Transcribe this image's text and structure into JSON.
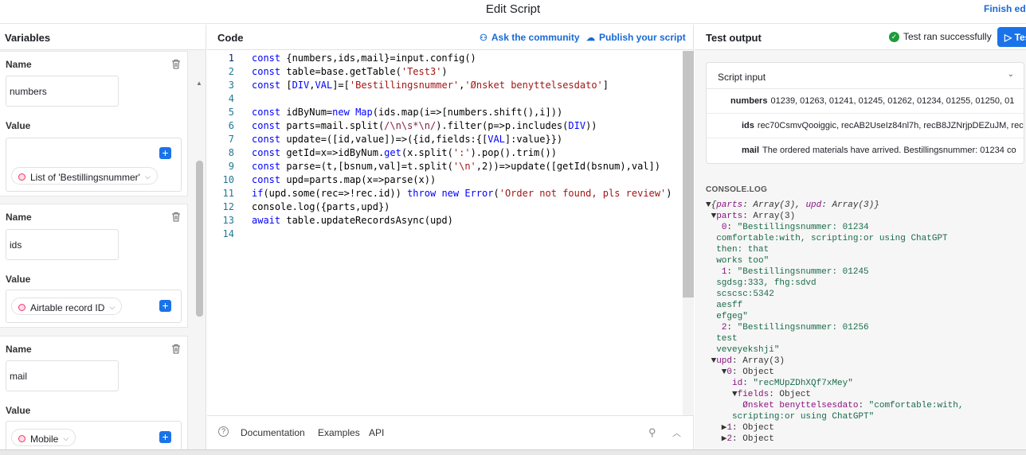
{
  "header": {
    "title": "Edit Script",
    "finish_label": "Finish editing"
  },
  "variables": {
    "title": "Variables",
    "name_label": "Name",
    "value_label": "Value",
    "items": [
      {
        "name": "numbers",
        "value_label": "List of 'Bestillingsnummer'"
      },
      {
        "name": "ids",
        "value_label": "Airtable record ID"
      },
      {
        "name": "mail",
        "value_label": "Mobile"
      }
    ]
  },
  "code": {
    "title": "Code",
    "ask_community": "Ask the community",
    "publish": "Publish your script",
    "line_numbers": [
      "1",
      "2",
      "3",
      "4",
      "5",
      "6",
      "7",
      "8",
      "9",
      "10",
      "11",
      "12",
      "13",
      "14"
    ],
    "footer": {
      "documentation": "Documentation",
      "examples": "Examples",
      "api": "API"
    }
  },
  "output": {
    "title": "Test output",
    "status": "Test ran successfully",
    "test_button": "Test",
    "script_input": {
      "title": "Script input",
      "rows": [
        {
          "key": "numbers",
          "value": "01239, 01263, 01241, 01245, 01262, 01234, 01255, 01250, 01"
        },
        {
          "key": "ids",
          "value": "rec70CsmvQooiggic, recAB2UseIz84nl7h, recB8JZNrjpDEZuJM, rec"
        },
        {
          "key": "mail",
          "value": "The ordered materials have arrived. Bestillingsnummer: 01234 co"
        }
      ]
    },
    "console_label": "CONSOLE.LOG"
  },
  "colors": {
    "accent": "#1a73e8",
    "success": "#1e9b3b"
  }
}
